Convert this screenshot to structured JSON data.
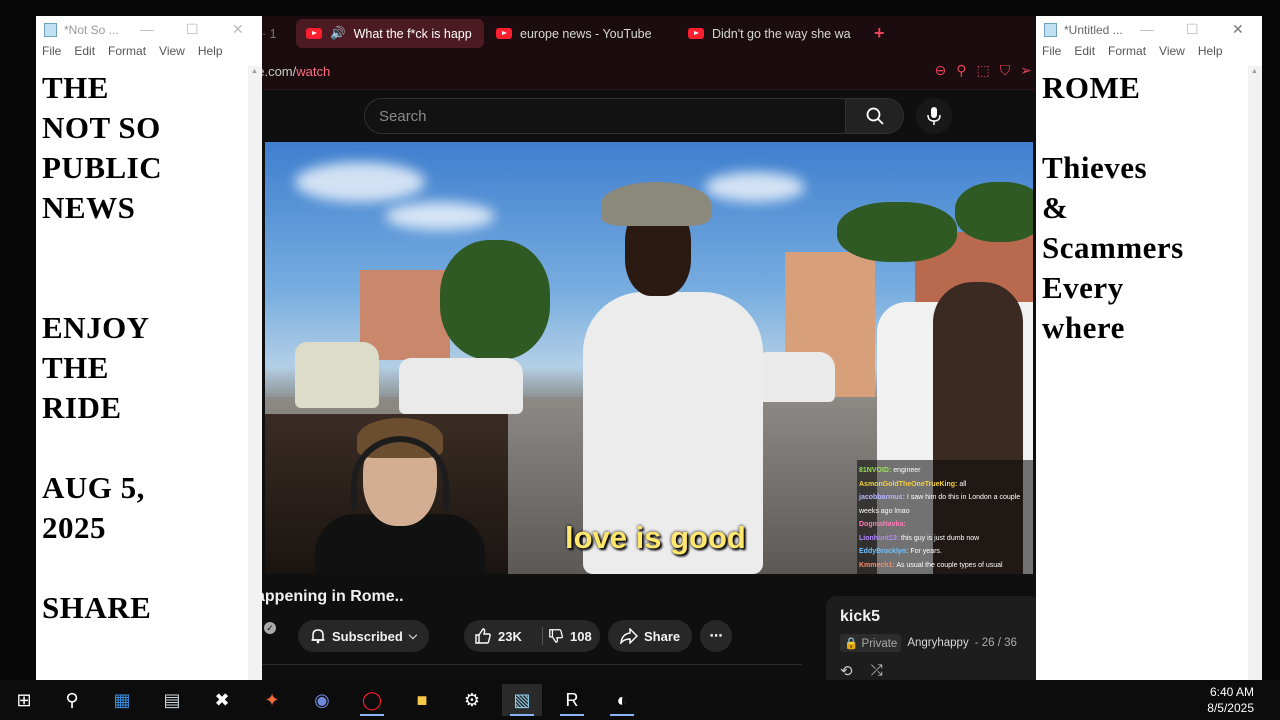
{
  "browser": {
    "tabs": [
      {
        "label": "What the f*ck is happ",
        "active": true
      },
      {
        "label": "europe news - YouTube",
        "active": false
      },
      {
        "label": "Didn't go the way she wa",
        "active": false
      }
    ],
    "new_tab_label": "+",
    "url_host": "be.com/",
    "url_path": "watch"
  },
  "youtube": {
    "search_placeholder": "Search",
    "video": {
      "subtitle": "love is good",
      "chat": [
        {
          "user": "81NVOID:",
          "msg": "engineer",
          "color": "#9be05a"
        },
        {
          "user": "AsmonGoldTheOneTrueKing:",
          "msg": "all",
          "color": "#f5d142"
        },
        {
          "user": "jacobbarmus:",
          "msg": "I saw him do this in London a couple weeks ago lmao",
          "color": "#b7b7ff"
        },
        {
          "user": "DogmaNavka:",
          "msg": "",
          "color": "#ff7ab8"
        },
        {
          "user": "Lionhunt13:",
          "msg": "this guy is just dumb now",
          "color": "#b388ff"
        },
        {
          "user": "EddyBrocklyn:",
          "msg": "For years.",
          "color": "#6fc3ff"
        },
        {
          "user": "Kmmech1:",
          "msg": "As usual the couple types of usual suspects",
          "color": "#ff8a65"
        }
      ]
    },
    "title": "appening in Rome..",
    "subscribed_label": "Subscribed",
    "likes": "23K",
    "dislikes": "108",
    "share_label": "Share",
    "more_label": "⋯",
    "playlist": {
      "name": "kick5",
      "privacy": "Private",
      "owner": "Angryhappy",
      "position": "- 26 / 36"
    }
  },
  "notepad_left": {
    "title": "*Not So ...",
    "menu": [
      "File",
      "Edit",
      "Format",
      "View",
      "Help"
    ],
    "text": "THE\nNOT SO\nPUBLIC\nNEWS\n\n\nENJOY\nTHE\nRIDE\n\nAUG 5,\n2025\n\nSHARE"
  },
  "notepad_right": {
    "title": "*Untitled ...",
    "menu": [
      "File",
      "Edit",
      "Format",
      "View",
      "Help"
    ],
    "text": "ROME\n\nThieves\n&\nScammers\nEvery\nwhere"
  },
  "taskbar": {
    "time": "6:40 AM",
    "date": "8/5/2025",
    "icons": [
      {
        "name": "start-icon",
        "glyph": "⊞",
        "color": "#ffffff"
      },
      {
        "name": "search-icon",
        "glyph": "⚲",
        "color": "#ffffff"
      },
      {
        "name": "calculator-icon",
        "glyph": "▦",
        "color": "#3b8fe0"
      },
      {
        "name": "files-icon",
        "glyph": "▤",
        "color": "#cfd8dc"
      },
      {
        "name": "x-app-icon",
        "glyph": "✖",
        "color": "#ffffff"
      },
      {
        "name": "affinity-icon",
        "glyph": "✦",
        "color": "#f06a3a"
      },
      {
        "name": "discord-icon",
        "glyph": "◉",
        "color": "#7289da"
      },
      {
        "name": "opera-icon",
        "glyph": "◯",
        "color": "#ff1b2d"
      },
      {
        "name": "folder-icon",
        "glyph": "■",
        "color": "#f7c948"
      },
      {
        "name": "settings-icon",
        "glyph": "⚙",
        "color": "#ffffff"
      },
      {
        "name": "notepad-icon",
        "glyph": "▧",
        "color": "#8fd0f0"
      },
      {
        "name": "r-app-icon",
        "glyph": "R",
        "color": "#ffffff"
      },
      {
        "name": "obs-icon",
        "glyph": "◐",
        "color": "#ffffff"
      }
    ]
  }
}
